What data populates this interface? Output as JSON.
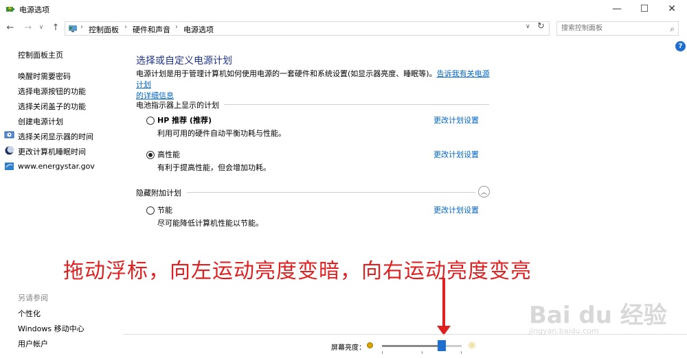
{
  "window": {
    "title": "电源选项",
    "minimize": "—",
    "maximize": "☐",
    "close": "✕"
  },
  "nav": {
    "back": "←",
    "forward": "→",
    "history": "∨",
    "up": "↑",
    "breadcrumb": [
      "控制面板",
      "硬件和声音",
      "电源选项"
    ],
    "search_placeholder": "搜索控制面板",
    "refresh": "↻"
  },
  "leftnav": {
    "items": [
      "控制面板主页",
      "唤醒时需要密码",
      "选择电源按钮的功能",
      "选择关闭盖子的功能",
      "创建电源计划",
      "选择关闭显示器的时间",
      "更改计算机睡眠时间",
      "www.energystar.gov"
    ],
    "see_also_heading": "另请参阅",
    "see_also": [
      "个性化",
      "Windows 移动中心",
      "用户帐户"
    ]
  },
  "main": {
    "title": "选择或自定义电源计划",
    "desc_text": "电源计划是用于管理计算机如何使用电源的一套硬件和系统设置(如显示器亮度、睡眠等)。",
    "desc_link_1": "告诉我有关电源计划",
    "desc_link_2": "的详细信息",
    "section_battery": "电池指示器上显示的计划",
    "section_hidden": "隐藏附加计划",
    "plans": [
      {
        "name": "HP 推荐 (推荐)",
        "desc": "利用可用的硬件自动平衡功耗与性能。",
        "link": "更改计划设置",
        "selected": false
      },
      {
        "name": "高性能",
        "desc": "有利于提高性能，但会增加功耗。",
        "link": "更改计划设置",
        "selected": true
      },
      {
        "name": "节能",
        "desc": "尽可能降低计算机性能以节能。",
        "link": "更改计划设置",
        "selected": false
      }
    ]
  },
  "annotation": "拖动浮标，向左运动亮度变暗，向右运动亮度变亮",
  "brightness": {
    "label": "屏幕亮度：",
    "level": 0.75
  },
  "watermark": {
    "text": "Bai du 经验",
    "sub": "jingyan.baidu.com"
  },
  "colors": {
    "link": "#0066cc",
    "title": "#1e3287",
    "annotation": "#e02020",
    "slider_thumb": "#1e6fcf"
  }
}
